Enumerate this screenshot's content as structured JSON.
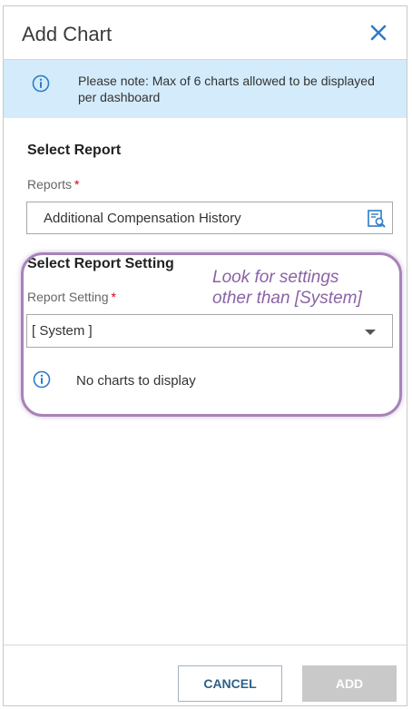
{
  "dialog": {
    "title": "Add Chart",
    "close_icon": "close-icon"
  },
  "notice": {
    "icon": "info-icon",
    "text": "Please note: Max of 6 charts allowed to be displayed per dashboard"
  },
  "select_report": {
    "heading": "Select Report",
    "label": "Reports",
    "required_mark": "*",
    "value": "Additional Compensation History",
    "lookup_icon": "report-lookup-icon"
  },
  "select_report_setting": {
    "heading": "Select Report Setting",
    "label": "Report Setting",
    "required_mark": "*",
    "selected": "[ System ]",
    "dropdown_icon": "chevron-down-icon"
  },
  "empty_state": {
    "icon": "info-icon",
    "text": "No charts to display"
  },
  "annotation": {
    "line1": "Look for settings",
    "line2": "other than [System]",
    "color": "#8a62a6"
  },
  "footer": {
    "cancel_label": "CANCEL",
    "add_label": "ADD"
  },
  "colors": {
    "notice_bg": "#d3ebfa",
    "accent": "#2e7bc8",
    "required": "#d0021b",
    "disabled_button": "#c9c9c9"
  }
}
